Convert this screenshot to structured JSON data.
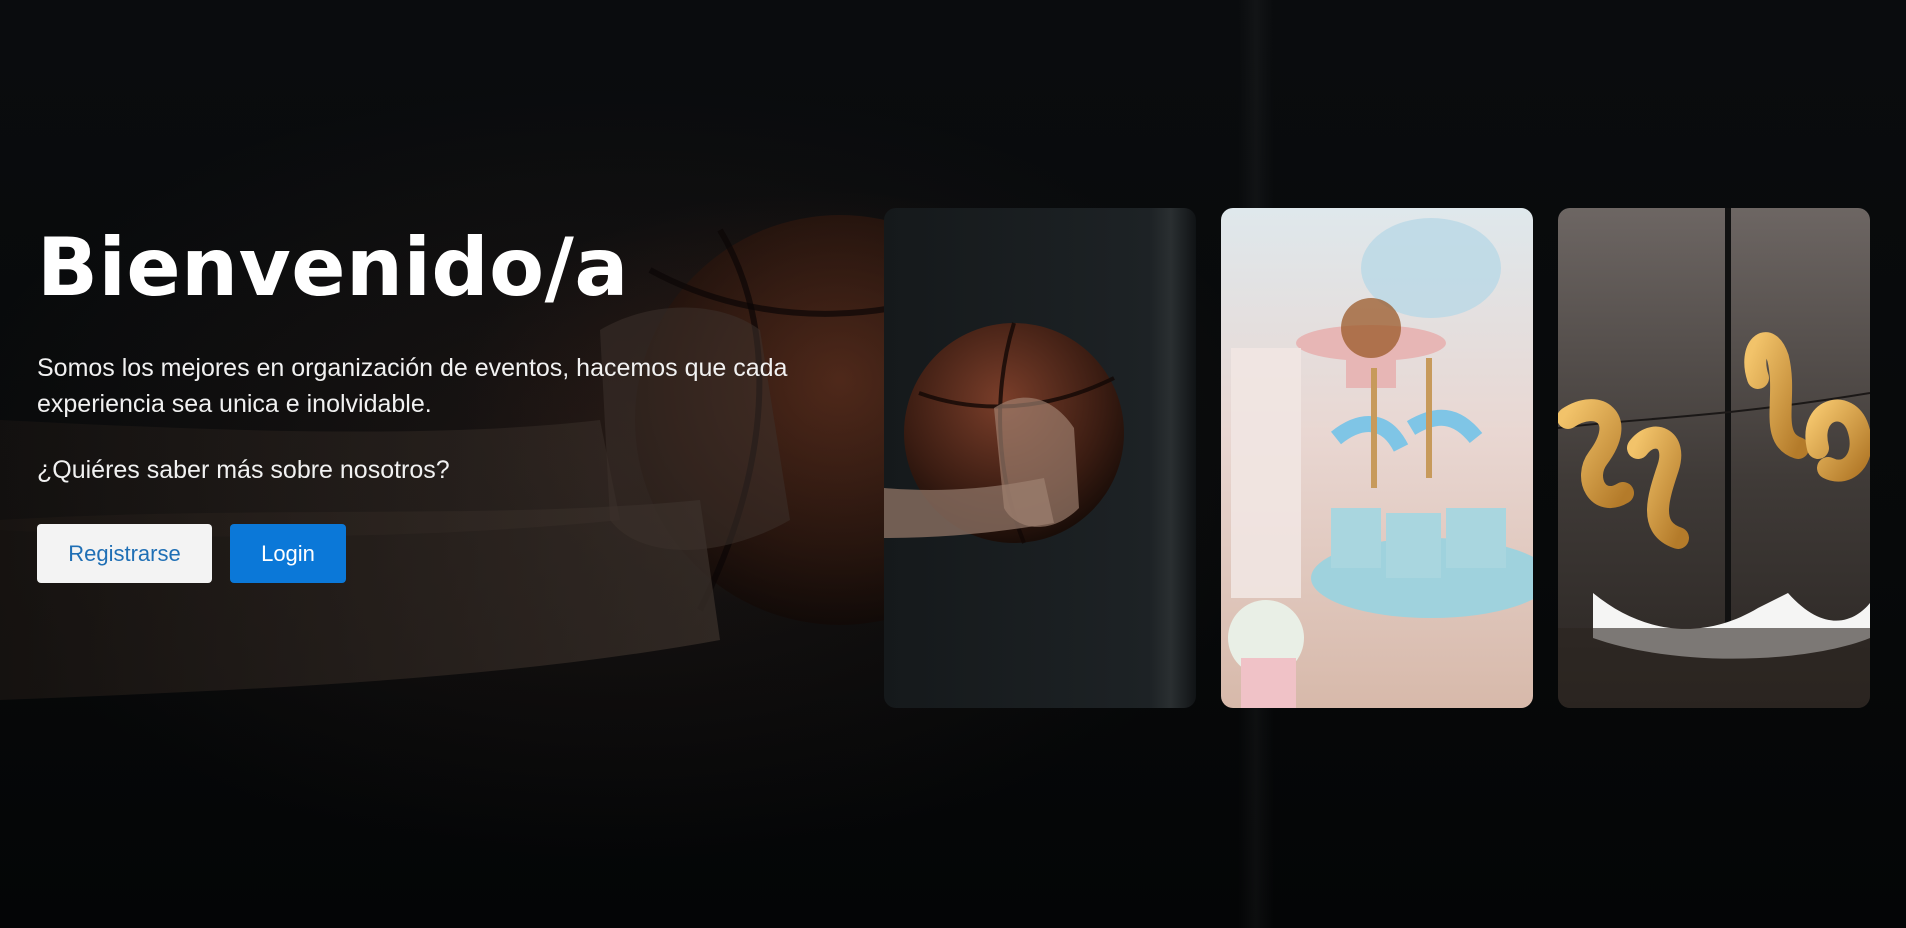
{
  "hero": {
    "title": "Bienvenido/a",
    "description": "Somos los mejores en organización de eventos, hacemos que cada experiencia sea unica e inolvidable.",
    "question": "¿Quiéres saber más sobre nosotros?",
    "register_label": "Registrarse",
    "login_label": "Login"
  },
  "cards": [
    {
      "image": "basketball-photo"
    },
    {
      "image": "party-desserts-photo"
    },
    {
      "image": "baby-balloons-photo"
    }
  ],
  "colors": {
    "background": "#050607",
    "title": "#ffffff",
    "register_bg": "#f3f3f3",
    "register_text": "#1f6fb5",
    "login_bg": "#0b78d8",
    "login_text": "#ffffff"
  }
}
